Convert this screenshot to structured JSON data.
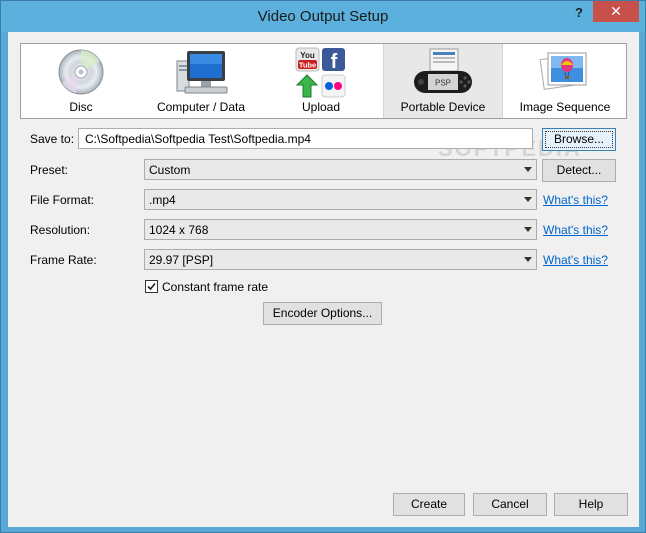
{
  "window": {
    "title": "Video Output Setup",
    "help_label": "?",
    "close_label": "✕"
  },
  "tabs": [
    {
      "label": "Disc",
      "icon": "disc-icon"
    },
    {
      "label": "Computer / Data",
      "icon": "computer-icon"
    },
    {
      "label": "Upload",
      "icon": "upload-icon"
    },
    {
      "label": "Portable Device",
      "icon": "psp-icon"
    },
    {
      "label": "Image Sequence",
      "icon": "image-sequence-icon"
    }
  ],
  "upload_icon_text": {
    "youtube_top": "You",
    "youtube_bottom": "Tube",
    "facebook": "f"
  },
  "psp_text": "PSP",
  "form": {
    "save_to": {
      "label": "Save to:",
      "value": "C:\\Softpedia\\Softpedia Test\\Softpedia.mp4",
      "browse": "Browse..."
    },
    "preset": {
      "label": "Preset:",
      "value": "Custom",
      "detect": "Detect..."
    },
    "file_format": {
      "label": "File Format:",
      "value": ".mp4",
      "link": "What's this?"
    },
    "resolution": {
      "label": "Resolution:",
      "value": "1024 x 768",
      "link": "What's this?"
    },
    "frame_rate": {
      "label": "Frame Rate:",
      "value": "29.97 [PSP]",
      "link": "What's this?"
    },
    "constant_frame_rate": {
      "label": "Constant frame rate",
      "checked": true
    },
    "encoder_options": "Encoder Options..."
  },
  "footer": {
    "create": "Create",
    "cancel": "Cancel",
    "help": "Help"
  },
  "watermark": "SOFTPEDIA",
  "colors": {
    "title_bar": "#5bb0de",
    "close_button": "#c7504b",
    "link": "#0066cc"
  }
}
